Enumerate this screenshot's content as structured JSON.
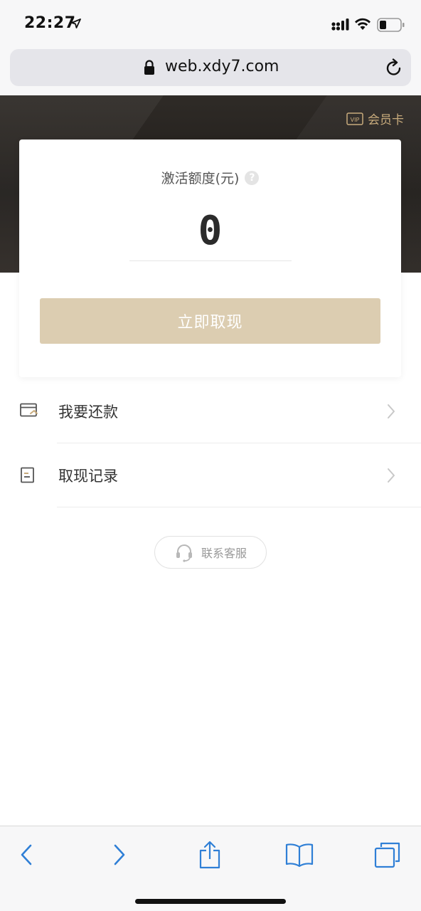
{
  "status_bar": {
    "time": "22:27"
  },
  "browser": {
    "url": "web.xdy7.com"
  },
  "hero": {
    "vip_label": "会员卡",
    "vip_badge": "VIP",
    "accent_color": "#c8ab7c"
  },
  "card": {
    "label": "激活额度(元)",
    "help_glyph": "?",
    "amount": "0",
    "withdraw_button": "立即取现",
    "button_color": "#dccdb1"
  },
  "list": [
    {
      "label": "我要还款",
      "icon": "repay-card-icon"
    },
    {
      "label": "取现记录",
      "icon": "record-document-icon"
    }
  ],
  "customer_service": {
    "label": "联系客服",
    "icon": "headset-icon"
  },
  "toolbar": {
    "icons": [
      "back-icon",
      "forward-icon",
      "share-icon",
      "bookmarks-icon",
      "tabs-icon"
    ],
    "tint": "#2f7fd6"
  }
}
